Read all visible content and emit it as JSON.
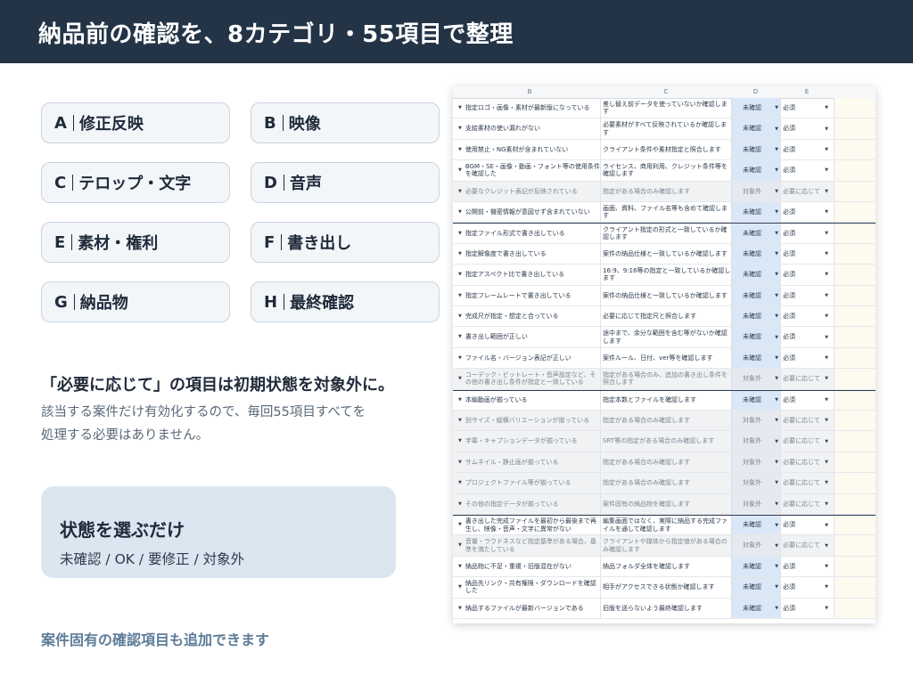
{
  "header": {
    "title": "納品前の確認を、8カテゴリ・55項目で整理"
  },
  "categories": [
    {
      "letter": "A",
      "name": "修正反映"
    },
    {
      "letter": "B",
      "name": "映像"
    },
    {
      "letter": "C",
      "name": "テロップ・文字"
    },
    {
      "letter": "D",
      "name": "音声"
    },
    {
      "letter": "E",
      "name": "素材・権利"
    },
    {
      "letter": "F",
      "name": "書き出し"
    },
    {
      "letter": "G",
      "name": "納品物"
    },
    {
      "letter": "H",
      "name": "最終確認"
    }
  ],
  "note": {
    "title": "「必要に応じて」の項目は初期状態を対象外に。",
    "line1": "該当する案件だけ有効化するので、毎回55項目すべてを",
    "line2": "処理する必要はありません。"
  },
  "state_box": {
    "title": "状態を選ぶだけ",
    "values": "未確認 / OK / 要修正 / 対象外"
  },
  "footer_note": "案件固有の確認項目も追加できます",
  "sheet": {
    "columns": [
      "B",
      "C",
      "D",
      "E"
    ],
    "rows": [
      {
        "b": "指定ロゴ・画像・素材が最新版になっている",
        "c": "差し替え前データを使っていないか確認します",
        "d": "未確認",
        "e": "必須",
        "na": false,
        "sec": false
      },
      {
        "b": "支給素材の使い漏れがない",
        "c": "必要素材がすべて反映されているか確認します",
        "d": "未確認",
        "e": "必須",
        "na": false,
        "sec": false
      },
      {
        "b": "使用禁止・NG素材が含まれていない",
        "c": "クライアント条件や素材指定と照合します",
        "d": "未確認",
        "e": "必須",
        "na": false,
        "sec": false
      },
      {
        "b": "BGM・SE・画像・動画・フォント等の使用条件を確認した",
        "c": "ライセンス、商用利用、クレジット条件等を確認します",
        "d": "未確認",
        "e": "必須",
        "na": false,
        "sec": false
      },
      {
        "b": "必要なクレジット表記が反映されている",
        "c": "指定がある場合のみ確認します",
        "d": "対象外",
        "e": "必要に応じて",
        "na": true,
        "sec": false
      },
      {
        "b": "公開前・機密情報が意図せず含まれていない",
        "c": "画面、資料、ファイル名等も含めて確認します",
        "d": "未確認",
        "e": "必須",
        "na": false,
        "sec": false
      },
      {
        "b": "指定ファイル形式で書き出している",
        "c": "クライアント指定の形式と一致しているか確認します",
        "d": "未確認",
        "e": "必須",
        "na": false,
        "sec": true
      },
      {
        "b": "指定解像度で書き出している",
        "c": "案件の納品仕様と一致しているか確認します",
        "d": "未確認",
        "e": "必須",
        "na": false,
        "sec": false
      },
      {
        "b": "指定アスペクト比で書き出している",
        "c": "16:9、9:16等の指定と一致しているか確認します",
        "d": "未確認",
        "e": "必須",
        "na": false,
        "sec": false
      },
      {
        "b": "指定フレームレートで書き出している",
        "c": "案件の納品仕様と一致しているか確認します",
        "d": "未確認",
        "e": "必須",
        "na": false,
        "sec": false
      },
      {
        "b": "完成尺が指定・想定と合っている",
        "c": "必要に応じて指定尺と照合します",
        "d": "未確認",
        "e": "必須",
        "na": false,
        "sec": false
      },
      {
        "b": "書き出し範囲が正しい",
        "c": "途中まで、余分な範囲を含む等がないか確認します",
        "d": "未確認",
        "e": "必須",
        "na": false,
        "sec": false
      },
      {
        "b": "ファイル名・バージョン表記が正しい",
        "c": "案件ルール、日付、ver等を確認します",
        "d": "未確認",
        "e": "必須",
        "na": false,
        "sec": false
      },
      {
        "b": "コーデック・ビットレート・音声設定など、その他の書き出し条件が指定と一致している",
        "c": "指定がある場合のみ、追加の書き出し条件を照合します",
        "d": "対象外",
        "e": "必要に応じて",
        "na": true,
        "sec": false
      },
      {
        "b": "本編動画が揃っている",
        "c": "指定本数とファイルを確認します",
        "d": "未確認",
        "e": "必須",
        "na": false,
        "sec": true
      },
      {
        "b": "別サイズ・縦横バリエーションが揃っている",
        "c": "指定がある場合のみ確認します",
        "d": "対象外",
        "e": "必要に応じて",
        "na": true,
        "sec": false
      },
      {
        "b": "字幕・キャプションデータが揃っている",
        "c": "SRT等の指定がある場合のみ確認します",
        "d": "対象外",
        "e": "必要に応じて",
        "na": true,
        "sec": false
      },
      {
        "b": "サムネイル・静止画が揃っている",
        "c": "指定がある場合のみ確認します",
        "d": "対象外",
        "e": "必要に応じて",
        "na": true,
        "sec": false
      },
      {
        "b": "プロジェクトファイル等が揃っている",
        "c": "指定がある場合のみ確認します",
        "d": "対象外",
        "e": "必要に応じて",
        "na": true,
        "sec": false
      },
      {
        "b": "その他の指定データが揃っている",
        "c": "案件固有の納品物を確認します",
        "d": "対象外",
        "e": "必要に応じて",
        "na": true,
        "sec": false
      },
      {
        "b": "書き出した完成ファイルを最初から最後まで再生し、映像・音声・文字に異常がない",
        "c": "編集画面ではなく、実際に納品する完成ファイルを通して確認します",
        "d": "未確認",
        "e": "必須",
        "na": false,
        "sec": true
      },
      {
        "b": "音量・ラウドネスなど指定基準がある場合、基準を満たしている",
        "c": "クライアントや媒体から指定値がある場合のみ確認します",
        "d": "対象外",
        "e": "必要に応じて",
        "na": true,
        "sec": false
      },
      {
        "b": "納品物に不足・重複・旧版混在がない",
        "c": "納品フォルダ全体を確認します",
        "d": "未確認",
        "e": "必須",
        "na": false,
        "sec": false
      },
      {
        "b": "納品先リンク・共有権限・ダウンロードを確認した",
        "c": "相手がアクセスできる状態か確認します",
        "d": "未確認",
        "e": "必須",
        "na": false,
        "sec": false
      },
      {
        "b": "納品するファイルが最新バージョンである",
        "c": "旧版を送らないよう最終確認します",
        "d": "未確認",
        "e": "必須",
        "na": false,
        "sec": false
      }
    ]
  }
}
